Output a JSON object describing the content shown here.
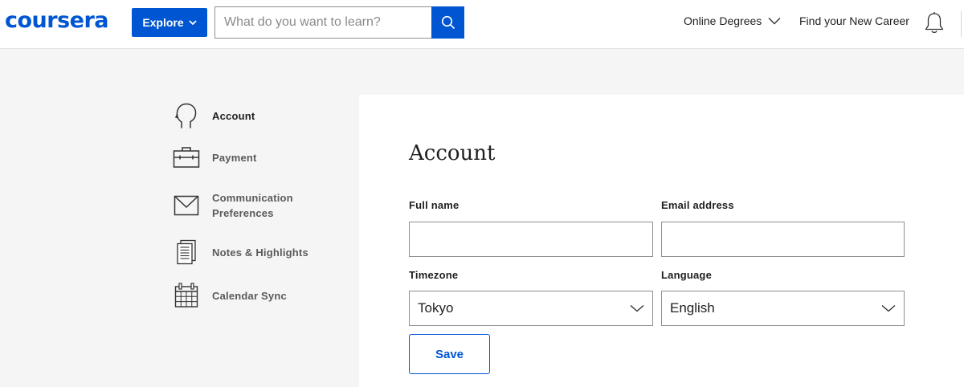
{
  "header": {
    "logo_text": "coursera",
    "explore_label": "Explore",
    "search": {
      "placeholder": "What do you want to learn?",
      "value": ""
    },
    "nav": {
      "online_degrees": "Online Degrees",
      "find_career": "Find your New Career"
    },
    "icons": [
      "chevron-down-icon",
      "search-icon",
      "bell-icon"
    ]
  },
  "sidebar": {
    "items": [
      {
        "label": "Account",
        "icon": "head-icon",
        "active": true
      },
      {
        "label": "Payment",
        "icon": "briefcase-icon",
        "active": false
      },
      {
        "label": "Communication",
        "label2": "Preferences",
        "icon": "envelope-icon",
        "active": false
      },
      {
        "label": "Notes & Highlights",
        "icon": "notes-icon",
        "active": false
      },
      {
        "label": "Calendar Sync",
        "icon": "calendar-icon",
        "active": false
      }
    ]
  },
  "main": {
    "title": "Account",
    "fields": {
      "full_name": {
        "label": "Full name",
        "value": ""
      },
      "email": {
        "label": "Email address",
        "value": ""
      },
      "timezone": {
        "label": "Timezone",
        "value": "Tokyo"
      },
      "language": {
        "label": "Language",
        "value": "English"
      }
    },
    "save_label": "Save"
  },
  "colors": {
    "brand": "#0056d2",
    "background": "#f5f5f5",
    "panel": "#ffffff",
    "border": "#8f8f8f"
  }
}
